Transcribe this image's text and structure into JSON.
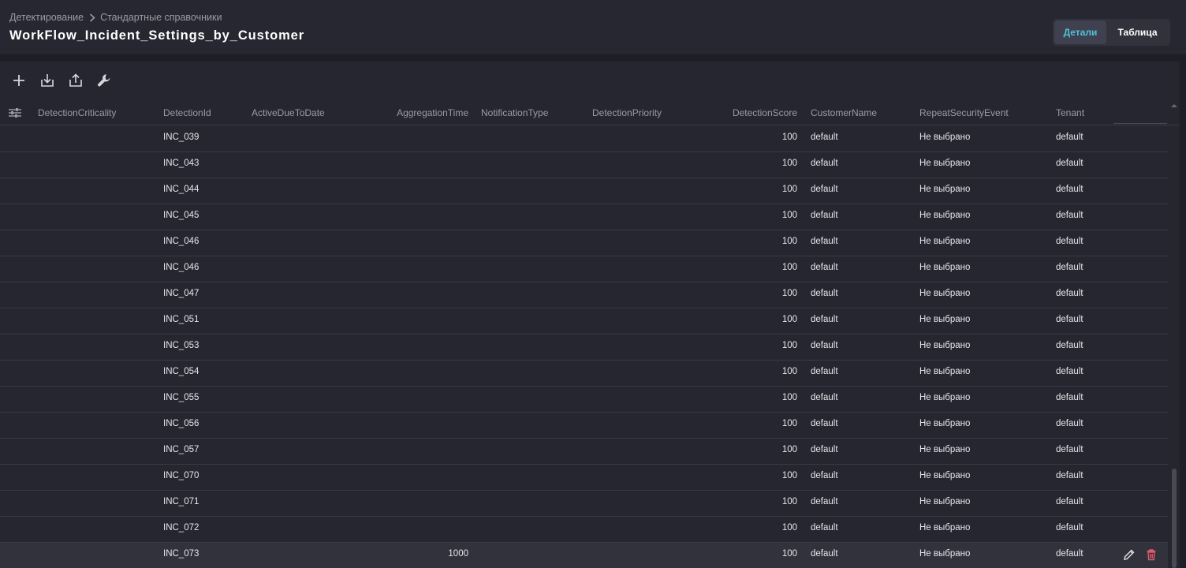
{
  "breadcrumb": {
    "parent": "Детектирование",
    "current": "Стандартные справочники"
  },
  "title": "WorkFlow_Incident_Settings_by_Customer",
  "view_toggle": {
    "details": "Детали",
    "table": "Таблица"
  },
  "toolbar": {
    "add_icon": "plus-icon",
    "import_icon": "download-icon",
    "export_icon": "upload-icon",
    "settings_icon": "wrench-icon"
  },
  "colors": {
    "accent": "#4fc3d4",
    "delete": "#e05a6a",
    "background": "#262630"
  },
  "columns": {
    "detection_criticality": "DetectionCriticality",
    "detection_id": "DetectionId",
    "active_due_to_date": "ActiveDueToDate",
    "aggregation_time": "AggregationTime",
    "notification_type": "NotificationType",
    "detection_priority": "DetectionPriority",
    "detection_score": "DetectionScore",
    "customer_name": "CustomerName",
    "repeat_security_event": "RepeatSecurityEvent",
    "tenant": "Tenant"
  },
  "rows": [
    {
      "detection_id": "INC_039",
      "aggregation_time": "",
      "detection_score": "100",
      "customer_name": "default",
      "repeat_security_event": "Не выбрано",
      "tenant": "default"
    },
    {
      "detection_id": "INC_043",
      "aggregation_time": "",
      "detection_score": "100",
      "customer_name": "default",
      "repeat_security_event": "Не выбрано",
      "tenant": "default"
    },
    {
      "detection_id": "INC_044",
      "aggregation_time": "",
      "detection_score": "100",
      "customer_name": "default",
      "repeat_security_event": "Не выбрано",
      "tenant": "default"
    },
    {
      "detection_id": "INC_045",
      "aggregation_time": "",
      "detection_score": "100",
      "customer_name": "default",
      "repeat_security_event": "Не выбрано",
      "tenant": "default"
    },
    {
      "detection_id": "INC_046",
      "aggregation_time": "",
      "detection_score": "100",
      "customer_name": "default",
      "repeat_security_event": "Не выбрано",
      "tenant": "default"
    },
    {
      "detection_id": "INC_046",
      "aggregation_time": "",
      "detection_score": "100",
      "customer_name": "default",
      "repeat_security_event": "Не выбрано",
      "tenant": "default"
    },
    {
      "detection_id": "INC_047",
      "aggregation_time": "",
      "detection_score": "100",
      "customer_name": "default",
      "repeat_security_event": "Не выбрано",
      "tenant": "default"
    },
    {
      "detection_id": "INC_051",
      "aggregation_time": "",
      "detection_score": "100",
      "customer_name": "default",
      "repeat_security_event": "Не выбрано",
      "tenant": "default"
    },
    {
      "detection_id": "INC_053",
      "aggregation_time": "",
      "detection_score": "100",
      "customer_name": "default",
      "repeat_security_event": "Не выбрано",
      "tenant": "default"
    },
    {
      "detection_id": "INC_054",
      "aggregation_time": "",
      "detection_score": "100",
      "customer_name": "default",
      "repeat_security_event": "Не выбрано",
      "tenant": "default"
    },
    {
      "detection_id": "INC_055",
      "aggregation_time": "",
      "detection_score": "100",
      "customer_name": "default",
      "repeat_security_event": "Не выбрано",
      "tenant": "default"
    },
    {
      "detection_id": "INC_056",
      "aggregation_time": "",
      "detection_score": "100",
      "customer_name": "default",
      "repeat_security_event": "Не выбрано",
      "tenant": "default"
    },
    {
      "detection_id": "INC_057",
      "aggregation_time": "",
      "detection_score": "100",
      "customer_name": "default",
      "repeat_security_event": "Не выбрано",
      "tenant": "default"
    },
    {
      "detection_id": "INC_070",
      "aggregation_time": "",
      "detection_score": "100",
      "customer_name": "default",
      "repeat_security_event": "Не выбрано",
      "tenant": "default"
    },
    {
      "detection_id": "INC_071",
      "aggregation_time": "",
      "detection_score": "100",
      "customer_name": "default",
      "repeat_security_event": "Не выбрано",
      "tenant": "default"
    },
    {
      "detection_id": "INC_072",
      "aggregation_time": "",
      "detection_score": "100",
      "customer_name": "default",
      "repeat_security_event": "Не выбрано",
      "tenant": "default"
    },
    {
      "detection_id": "INC_073",
      "aggregation_time": "1000",
      "detection_score": "100",
      "customer_name": "default",
      "repeat_security_event": "Не выбрано",
      "tenant": "default",
      "selected": true
    }
  ]
}
